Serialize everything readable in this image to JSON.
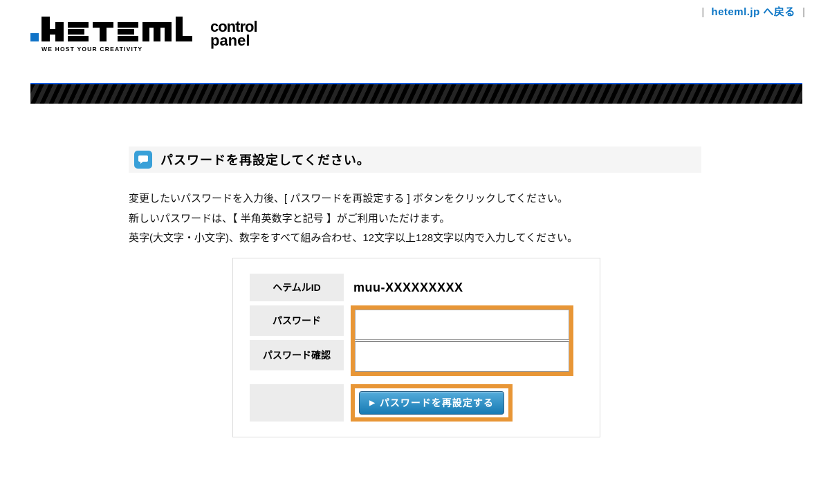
{
  "toplink": {
    "back_text": "heteml.jp へ戻る",
    "sep": "|"
  },
  "brand": {
    "name": "heteml",
    "tagline": "WE HOST YOUR CREATIVITY",
    "sub": "control panel"
  },
  "heading": "パスワードを再設定してください。",
  "instructions": {
    "l1": "変更したいパスワードを入力後、[ パスワードを再設定する ] ボタンをクリックしてください。",
    "l2": "新しいパスワードは、【 半角英数字と記号 】がご利用いただけます。",
    "l3": "英字(大文字・小文字)、数字をすべて組み合わせ、12文字以上128文字以内で入力してください。"
  },
  "form": {
    "id_label": "ヘテムルID",
    "id_value": "muu-XXXXXXXXX",
    "password_label": "パスワード",
    "password_confirm_label": "パスワード確認",
    "password_value": "",
    "password_confirm_value": "",
    "submit_label": "パスワードを再設定する",
    "submit_spacer": ""
  }
}
